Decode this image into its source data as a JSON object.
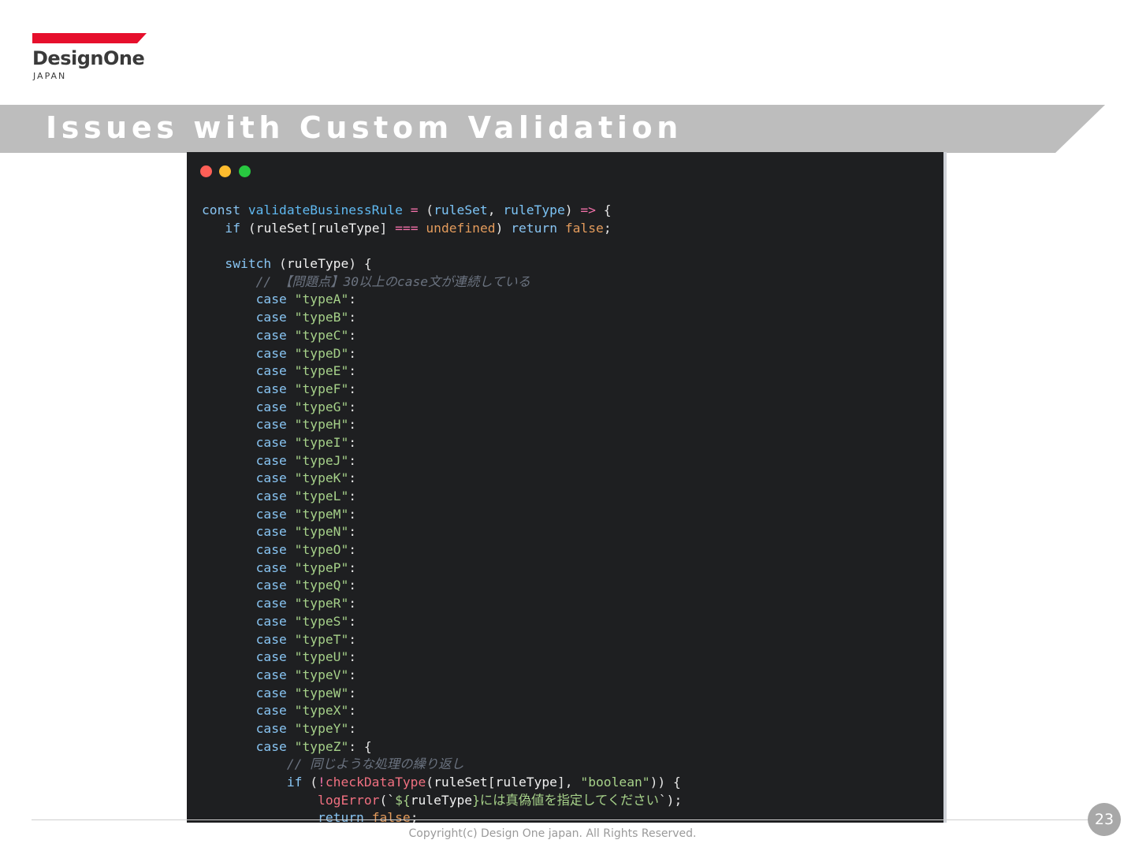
{
  "logo": {
    "name": "DesignOne",
    "sub": "JAPAN"
  },
  "title": "Issues with Custom Validation",
  "colors": {
    "brand_red": "#e60f2c",
    "title_band": "#bdbdbd",
    "code_bg": "#1e1f21"
  },
  "code": {
    "window_controls": [
      "close-dot",
      "minimize-dot",
      "maximize-dot"
    ],
    "lines": [
      [
        [
          "kw",
          "const "
        ],
        [
          "fn",
          "validateBusinessRule"
        ],
        [
          "plain",
          " "
        ],
        [
          "op",
          "="
        ],
        [
          "plain",
          " ("
        ],
        [
          "param",
          "ruleSet"
        ],
        [
          "plain",
          ", "
        ],
        [
          "param",
          "ruleType"
        ],
        [
          "plain",
          ") "
        ],
        [
          "op",
          "=>"
        ],
        [
          "plain",
          " {"
        ]
      ],
      [
        [
          "plain",
          "   "
        ],
        [
          "kw",
          "if"
        ],
        [
          "plain",
          " ("
        ],
        [
          "ident",
          "ruleSet"
        ],
        [
          "plain",
          "["
        ],
        [
          "ident",
          "ruleType"
        ],
        [
          "plain",
          "] "
        ],
        [
          "op",
          "==="
        ],
        [
          "plain",
          " "
        ],
        [
          "const",
          "undefined"
        ],
        [
          "plain",
          ") "
        ],
        [
          "kw",
          "return"
        ],
        [
          "plain",
          " "
        ],
        [
          "const",
          "false"
        ],
        [
          "plain",
          ";"
        ]
      ],
      [],
      [
        [
          "plain",
          "   "
        ],
        [
          "kw",
          "switch"
        ],
        [
          "plain",
          " ("
        ],
        [
          "ident",
          "ruleType"
        ],
        [
          "plain",
          ") {"
        ]
      ],
      [
        [
          "plain",
          "       "
        ],
        [
          "cmt",
          "// 【問題点】30以上のcase文が連続している"
        ]
      ],
      [
        [
          "plain",
          "       "
        ],
        [
          "kw",
          "case"
        ],
        [
          "plain",
          " "
        ],
        [
          "str",
          "\"typeA\""
        ],
        [
          "plain",
          ":"
        ]
      ],
      [
        [
          "plain",
          "       "
        ],
        [
          "kw",
          "case"
        ],
        [
          "plain",
          " "
        ],
        [
          "str",
          "\"typeB\""
        ],
        [
          "plain",
          ":"
        ]
      ],
      [
        [
          "plain",
          "       "
        ],
        [
          "kw",
          "case"
        ],
        [
          "plain",
          " "
        ],
        [
          "str",
          "\"typeC\""
        ],
        [
          "plain",
          ":"
        ]
      ],
      [
        [
          "plain",
          "       "
        ],
        [
          "kw",
          "case"
        ],
        [
          "plain",
          " "
        ],
        [
          "str",
          "\"typeD\""
        ],
        [
          "plain",
          ":"
        ]
      ],
      [
        [
          "plain",
          "       "
        ],
        [
          "kw",
          "case"
        ],
        [
          "plain",
          " "
        ],
        [
          "str",
          "\"typeE\""
        ],
        [
          "plain",
          ":"
        ]
      ],
      [
        [
          "plain",
          "       "
        ],
        [
          "kw",
          "case"
        ],
        [
          "plain",
          " "
        ],
        [
          "str",
          "\"typeF\""
        ],
        [
          "plain",
          ":"
        ]
      ],
      [
        [
          "plain",
          "       "
        ],
        [
          "kw",
          "case"
        ],
        [
          "plain",
          " "
        ],
        [
          "str",
          "\"typeG\""
        ],
        [
          "plain",
          ":"
        ]
      ],
      [
        [
          "plain",
          "       "
        ],
        [
          "kw",
          "case"
        ],
        [
          "plain",
          " "
        ],
        [
          "str",
          "\"typeH\""
        ],
        [
          "plain",
          ":"
        ]
      ],
      [
        [
          "plain",
          "       "
        ],
        [
          "kw",
          "case"
        ],
        [
          "plain",
          " "
        ],
        [
          "str",
          "\"typeI\""
        ],
        [
          "plain",
          ":"
        ]
      ],
      [
        [
          "plain",
          "       "
        ],
        [
          "kw",
          "case"
        ],
        [
          "plain",
          " "
        ],
        [
          "str",
          "\"typeJ\""
        ],
        [
          "plain",
          ":"
        ]
      ],
      [
        [
          "plain",
          "       "
        ],
        [
          "kw",
          "case"
        ],
        [
          "plain",
          " "
        ],
        [
          "str",
          "\"typeK\""
        ],
        [
          "plain",
          ":"
        ]
      ],
      [
        [
          "plain",
          "       "
        ],
        [
          "kw",
          "case"
        ],
        [
          "plain",
          " "
        ],
        [
          "str",
          "\"typeL\""
        ],
        [
          "plain",
          ":"
        ]
      ],
      [
        [
          "plain",
          "       "
        ],
        [
          "kw",
          "case"
        ],
        [
          "plain",
          " "
        ],
        [
          "str",
          "\"typeM\""
        ],
        [
          "plain",
          ":"
        ]
      ],
      [
        [
          "plain",
          "       "
        ],
        [
          "kw",
          "case"
        ],
        [
          "plain",
          " "
        ],
        [
          "str",
          "\"typeN\""
        ],
        [
          "plain",
          ":"
        ]
      ],
      [
        [
          "plain",
          "       "
        ],
        [
          "kw",
          "case"
        ],
        [
          "plain",
          " "
        ],
        [
          "str",
          "\"typeO\""
        ],
        [
          "plain",
          ":"
        ]
      ],
      [
        [
          "plain",
          "       "
        ],
        [
          "kw",
          "case"
        ],
        [
          "plain",
          " "
        ],
        [
          "str",
          "\"typeP\""
        ],
        [
          "plain",
          ":"
        ]
      ],
      [
        [
          "plain",
          "       "
        ],
        [
          "kw",
          "case"
        ],
        [
          "plain",
          " "
        ],
        [
          "str",
          "\"typeQ\""
        ],
        [
          "plain",
          ":"
        ]
      ],
      [
        [
          "plain",
          "       "
        ],
        [
          "kw",
          "case"
        ],
        [
          "plain",
          " "
        ],
        [
          "str",
          "\"typeR\""
        ],
        [
          "plain",
          ":"
        ]
      ],
      [
        [
          "plain",
          "       "
        ],
        [
          "kw",
          "case"
        ],
        [
          "plain",
          " "
        ],
        [
          "str",
          "\"typeS\""
        ],
        [
          "plain",
          ":"
        ]
      ],
      [
        [
          "plain",
          "       "
        ],
        [
          "kw",
          "case"
        ],
        [
          "plain",
          " "
        ],
        [
          "str",
          "\"typeT\""
        ],
        [
          "plain",
          ":"
        ]
      ],
      [
        [
          "plain",
          "       "
        ],
        [
          "kw",
          "case"
        ],
        [
          "plain",
          " "
        ],
        [
          "str",
          "\"typeU\""
        ],
        [
          "plain",
          ":"
        ]
      ],
      [
        [
          "plain",
          "       "
        ],
        [
          "kw",
          "case"
        ],
        [
          "plain",
          " "
        ],
        [
          "str",
          "\"typeV\""
        ],
        [
          "plain",
          ":"
        ]
      ],
      [
        [
          "plain",
          "       "
        ],
        [
          "kw",
          "case"
        ],
        [
          "plain",
          " "
        ],
        [
          "str",
          "\"typeW\""
        ],
        [
          "plain",
          ":"
        ]
      ],
      [
        [
          "plain",
          "       "
        ],
        [
          "kw",
          "case"
        ],
        [
          "plain",
          " "
        ],
        [
          "str",
          "\"typeX\""
        ],
        [
          "plain",
          ":"
        ]
      ],
      [
        [
          "plain",
          "       "
        ],
        [
          "kw",
          "case"
        ],
        [
          "plain",
          " "
        ],
        [
          "str",
          "\"typeY\""
        ],
        [
          "plain",
          ":"
        ]
      ],
      [
        [
          "plain",
          "       "
        ],
        [
          "kw",
          "case"
        ],
        [
          "plain",
          " "
        ],
        [
          "str",
          "\"typeZ\""
        ],
        [
          "plain",
          ": {"
        ]
      ],
      [
        [
          "plain",
          "           "
        ],
        [
          "cmt",
          "// 同じような処理の繰り返し"
        ]
      ],
      [
        [
          "plain",
          "           "
        ],
        [
          "kw",
          "if"
        ],
        [
          "plain",
          " ("
        ],
        [
          "op",
          "!"
        ],
        [
          "call",
          "checkDataType"
        ],
        [
          "plain",
          "("
        ],
        [
          "ident",
          "ruleSet"
        ],
        [
          "plain",
          "["
        ],
        [
          "ident",
          "ruleType"
        ],
        [
          "plain",
          "], "
        ],
        [
          "str",
          "\"boolean\""
        ],
        [
          "plain",
          ")) {"
        ]
      ],
      [
        [
          "plain",
          "               "
        ],
        [
          "call",
          "logError"
        ],
        [
          "plain",
          "(`"
        ],
        [
          "str",
          "${"
        ],
        [
          "ident",
          "ruleType"
        ],
        [
          "str",
          "}には真偽値を指定してください"
        ],
        [
          "plain",
          "`);"
        ]
      ],
      [
        [
          "plain",
          "               "
        ],
        [
          "kw",
          "return"
        ],
        [
          "plain",
          " "
        ],
        [
          "const",
          "false"
        ],
        [
          "plain",
          ";"
        ]
      ]
    ]
  },
  "footer": {
    "copyright": "Copyright(c) Design One japan. All Rights Reserved.",
    "page_number": "23"
  }
}
